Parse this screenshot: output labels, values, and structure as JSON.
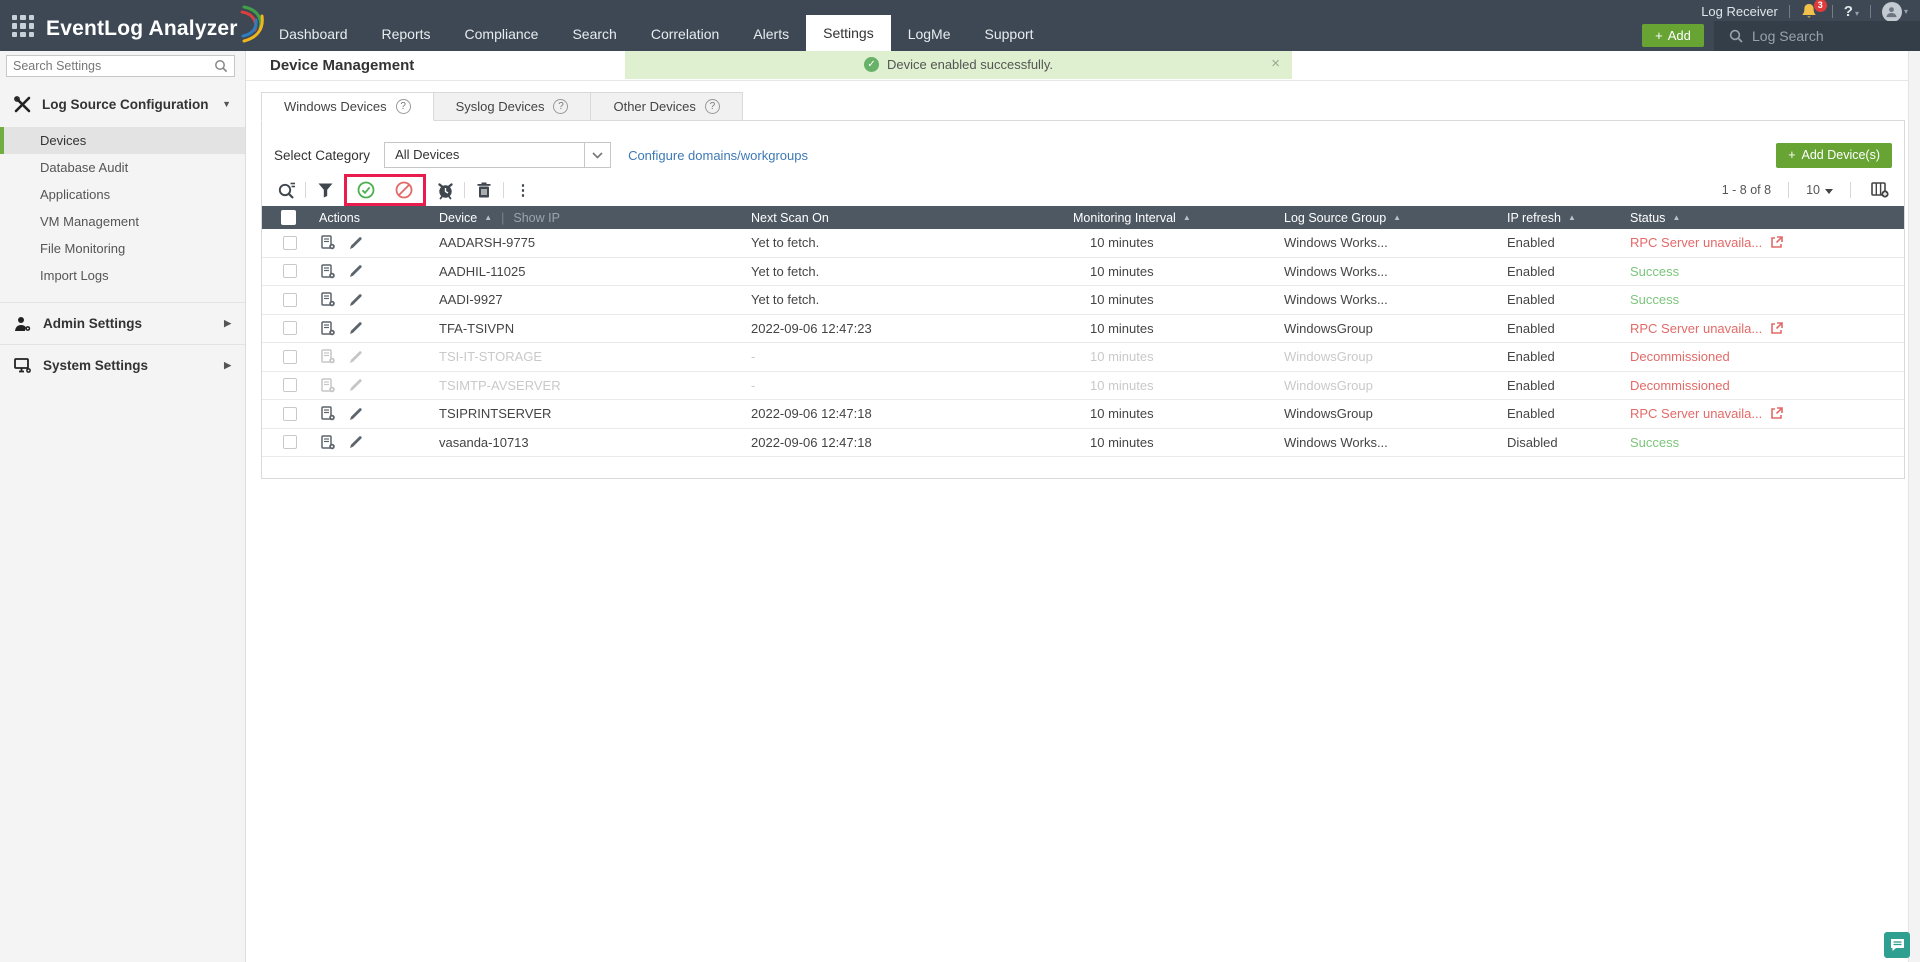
{
  "topbar": {
    "brand": "EventLog Analyzer",
    "nav": [
      {
        "label": "Dashboard",
        "active": false
      },
      {
        "label": "Reports",
        "active": false
      },
      {
        "label": "Compliance",
        "active": false
      },
      {
        "label": "Search",
        "active": false
      },
      {
        "label": "Correlation",
        "active": false
      },
      {
        "label": "Alerts",
        "active": false
      },
      {
        "label": "Settings",
        "active": true
      },
      {
        "label": "LogMe",
        "active": false
      },
      {
        "label": "Support",
        "active": false
      }
    ],
    "log_receiver": "Log Receiver",
    "notification_count": "3",
    "help_label": "?",
    "add_plus": "+",
    "add_button_label": "Add",
    "log_search": "Log Search"
  },
  "sidebar": {
    "search_placeholder": "Search Settings",
    "section1_label": "Log Source Configuration",
    "items": [
      {
        "label": "Devices",
        "selected": true
      },
      {
        "label": "Database Audit",
        "selected": false
      },
      {
        "label": "Applications",
        "selected": false
      },
      {
        "label": "VM Management",
        "selected": false
      },
      {
        "label": "File Monitoring",
        "selected": false
      },
      {
        "label": "Import Logs",
        "selected": false
      }
    ],
    "section2_label": "Admin Settings",
    "section3_label": "System Settings"
  },
  "page": {
    "title": "Device Management",
    "toast": {
      "message": "Device enabled successfully.",
      "close": "×"
    },
    "tabs": [
      {
        "label": "Windows Devices",
        "help": "?",
        "active": true
      },
      {
        "label": "Syslog Devices",
        "help": "?",
        "active": false
      },
      {
        "label": "Other Devices",
        "help": "?",
        "active": false
      }
    ],
    "category_label": "Select Category",
    "category_value": "All Devices",
    "configure_link": "Configure domains/workgroups",
    "add_device_plus": "+",
    "add_device_label": "Add Device(s)"
  },
  "toolbar": {
    "pagination": "1 - 8 of 8",
    "page_size": "10"
  },
  "table": {
    "headers": {
      "actions": "Actions",
      "device": "Device",
      "show_ip": "Show IP",
      "next_scan": "Next Scan On",
      "interval": "Monitoring Interval",
      "group": "Log Source Group",
      "ip_refresh": "IP refresh",
      "status": "Status"
    },
    "rows": [
      {
        "device": "AADARSH-9775",
        "next_scan": "Yet to fetch.",
        "interval": "10 minutes",
        "group": "Windows Works...",
        "ip_refresh": "Enabled",
        "status": "RPC Server unavaila...",
        "status_type": "error",
        "status_link": true,
        "muted": false
      },
      {
        "device": "AADHIL-11025",
        "next_scan": "Yet to fetch.",
        "interval": "10 minutes",
        "group": "Windows Works...",
        "ip_refresh": "Enabled",
        "status": "Success",
        "status_type": "success",
        "status_link": false,
        "muted": false
      },
      {
        "device": "AADI-9927",
        "next_scan": "Yet to fetch.",
        "interval": "10 minutes",
        "group": "Windows Works...",
        "ip_refresh": "Enabled",
        "status": "Success",
        "status_type": "success",
        "status_link": false,
        "muted": false
      },
      {
        "device": "TFA-TSIVPN",
        "next_scan": "2022-09-06 12:47:23",
        "interval": "10 minutes",
        "group": "WindowsGroup",
        "ip_refresh": "Enabled",
        "status": "RPC Server unavaila...",
        "status_type": "error",
        "status_link": true,
        "muted": false
      },
      {
        "device": "TSI-IT-STORAGE",
        "next_scan": "-",
        "interval": "10 minutes",
        "group": "WindowsGroup",
        "ip_refresh": "Enabled",
        "status": "Decommissioned",
        "status_type": "error",
        "status_link": false,
        "muted": true
      },
      {
        "device": "TSIMTP-AVSERVER",
        "next_scan": "-",
        "interval": "10 minutes",
        "group": "WindowsGroup",
        "ip_refresh": "Enabled",
        "status": "Decommissioned",
        "status_type": "error",
        "status_link": false,
        "muted": true
      },
      {
        "device": "TSIPRINTSERVER",
        "next_scan": "2022-09-06 12:47:18",
        "interval": "10 minutes",
        "group": "WindowsGroup",
        "ip_refresh": "Enabled",
        "status": "RPC Server unavaila...",
        "status_type": "error",
        "status_link": true,
        "muted": false
      },
      {
        "device": "vasanda-10713",
        "next_scan": "2022-09-06 12:47:18",
        "interval": "10 minutes",
        "group": "Windows Works...",
        "ip_refresh": "Disabled",
        "status": "Success",
        "status_type": "success",
        "status_link": false,
        "muted": false
      }
    ]
  },
  "colors": {
    "topbar": "#3d4854",
    "brand_green": "#67a434",
    "table_header": "#4d5863",
    "status_error": "#e26a68",
    "status_success": "#7cc47c",
    "highlight_box": "#ea1b4d",
    "link_blue": "#3e79b4",
    "selected_accent": "#6fae3f"
  }
}
